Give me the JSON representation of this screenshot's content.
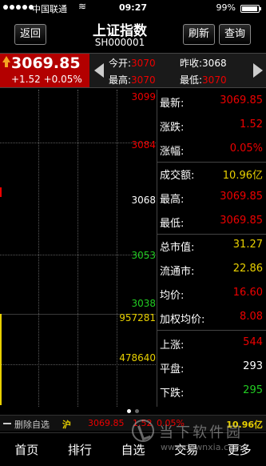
{
  "status_bar": {
    "carrier": "中国联通",
    "time": "09:27",
    "battery": "99%"
  },
  "header": {
    "back_label": "返回",
    "title": "上证指数",
    "code": "SH000001",
    "refresh_label": "刷新",
    "query_label": "查询"
  },
  "price_bar": {
    "price": "3069.85",
    "change": "+1.52 +0.05%",
    "open_label": "今开:",
    "open_value": "3070",
    "prev_close_label": "昨收:",
    "prev_close_value": "3068",
    "high_label": "最高:",
    "high_value": "3070",
    "low_label": "最低:",
    "low_value": "3070"
  },
  "chart": {
    "price_labels": [
      "3099",
      "3084",
      "3068",
      "3053",
      "3038"
    ],
    "volume_labels": [
      "957281",
      "478640"
    ]
  },
  "info_panel": [
    {
      "label": "最新:",
      "value": "3069.85",
      "color": "red"
    },
    {
      "label": "涨跌:",
      "value": "1.52",
      "color": "red"
    },
    {
      "label": "涨幅:",
      "value": "0.05%",
      "color": "red"
    },
    {
      "label": "成交额:",
      "value": "10.96亿",
      "color": "yellow"
    },
    {
      "label": "最高:",
      "value": "3069.85",
      "color": "red"
    },
    {
      "label": "最低:",
      "value": "3069.85",
      "color": "red"
    },
    {
      "label": "总市值:",
      "value": "31.27",
      "color": "yellow"
    },
    {
      "label": "流通市:",
      "value": "22.86",
      "color": "yellow"
    },
    {
      "label": "均价:",
      "value": "16.60",
      "color": "red"
    },
    {
      "label": "加权均价:",
      "value": "8.08",
      "color": "red"
    },
    {
      "label": "上涨:",
      "value": "544",
      "color": "red"
    },
    {
      "label": "平盘:",
      "value": "293",
      "color": "white"
    },
    {
      "label": "下跌:",
      "value": "295",
      "color": "green"
    }
  ],
  "ticker": {
    "delete_label": "删除自选",
    "market": "沪",
    "price": "3069.85",
    "change": "1.52",
    "ratio": "0.05%",
    "amount": "10.96亿"
  },
  "tabs": [
    "首页",
    "排行",
    "自选",
    "交易",
    "更多"
  ],
  "watermark": {
    "name": "当下软件园",
    "url": "www.downxia.com"
  },
  "colors": {
    "up": "#e00000",
    "down": "#22cc22",
    "accent": "#e8d000",
    "price_box": "#b30000"
  }
}
